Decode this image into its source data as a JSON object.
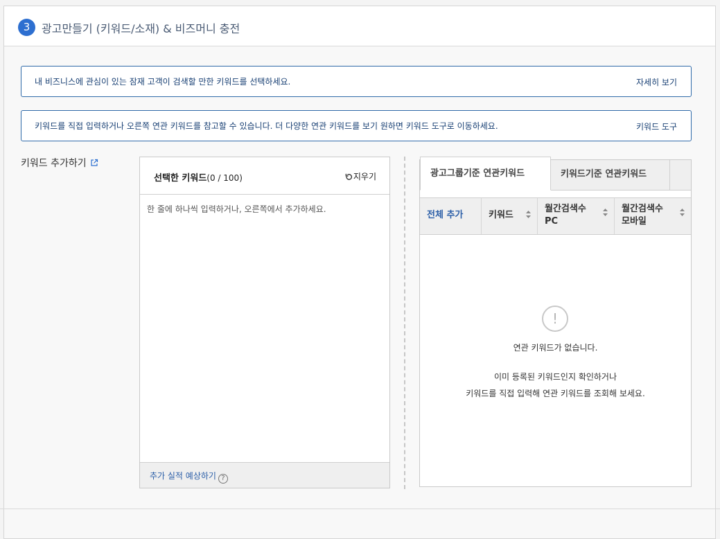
{
  "step": {
    "number": "3",
    "title": "광고만들기 (키워드/소재) & 비즈머니 충전"
  },
  "info_banners": [
    {
      "text": "내 비즈니스에 관심이 있는 잠재 고객이 검색할 만한 키워드를 선택하세요.",
      "link": "자세히 보기"
    },
    {
      "text": "키워드를 직접 입력하거나 오른쪽 연관 키워드를 참고할 수 있습니다. 더 다양한 연관 키워드를 보기 원하면 키워드 도구로 이동하세요.",
      "link": "키워드 도구"
    }
  ],
  "add_keywords": {
    "label": "키워드 추가하기",
    "icon": "external-link-icon"
  },
  "selected": {
    "title": "선택한 키워드",
    "count": "(0 / 100)",
    "clear": "지우기",
    "clear_icon": "refresh-icon",
    "placeholder": "한 줄에 하나씩 입력하거나, 오른쪽에서 추가하세요.",
    "value": "",
    "forecast": "추가 실적 예상하기",
    "help": "?"
  },
  "related": {
    "tabs": [
      "광고그룹기준 연관키워드",
      "키워드기준 연관키워드"
    ],
    "active_tab": 0,
    "columns": [
      {
        "label": "전체 추가"
      },
      {
        "label": "키워드"
      },
      {
        "label_line1": "월간검색수",
        "label_line2": "PC"
      },
      {
        "label_line1": "월간검색수",
        "label_line2": "모바일"
      }
    ],
    "empty_icon": "exclamation-icon",
    "empty_title": "연관 키워드가 없습니다.",
    "empty_line1": "이미 등록된 키워드인지 확인하거나",
    "empty_line2": "키워드를 직접 입력해 연관 키워드를 조회해 보세요."
  },
  "colors": {
    "accent": "#2d6fd0",
    "link": "#2c5fa8",
    "banner_border": "#2f6aa9"
  }
}
